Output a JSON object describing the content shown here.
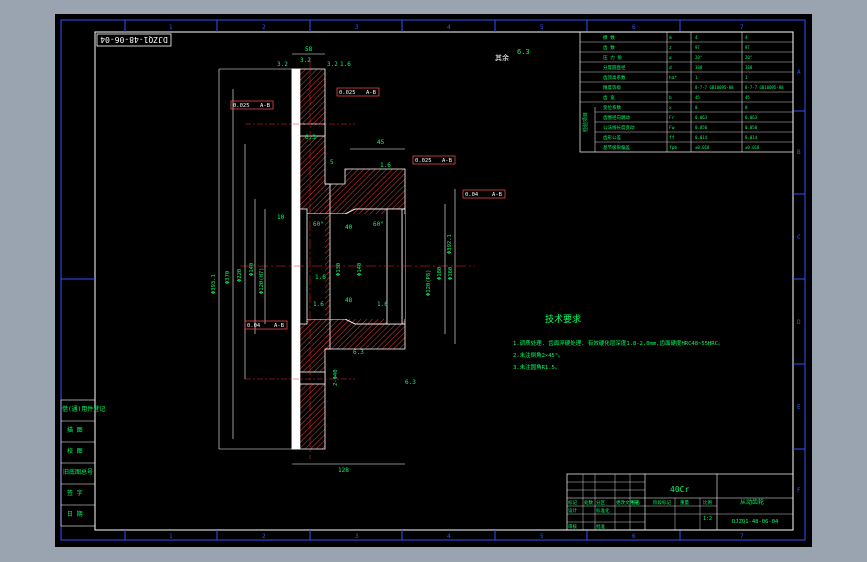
{
  "drawing_code_rotated": "DJZQ1-48-06-04",
  "surface_roughness_all": "6.3",
  "surface_roughness_prefix": "其余",
  "dims": {
    "top_width": "58",
    "r1": "3.2",
    "r2": "3.2",
    "r3": "3.2",
    "r4": "1.6",
    "r5": "6.3",
    "r6": "1.6",
    "r7": "1.6",
    "r8": "1.6",
    "r9": "1.6",
    "r10": "6.3",
    "w_hub": "48",
    "w_15": "5",
    "w_10": "10",
    "w_40": "40",
    "w_right": "45",
    "bottom_len": "128",
    "angle1": "60°",
    "angle2": "60°",
    "phi_outer": "Φ393.1",
    "phi_a": "Φ370",
    "phi_b": "Φ220",
    "phi_c": "Φ140",
    "phi_d": "Φ120(H7)",
    "phi_e": "Φ130",
    "phi_f": "Φ120(P8)",
    "phi_g": "Φ180",
    "phi_h": "Φ160",
    "phi_i": "Φ140",
    "phi_j": "Φ392.1",
    "bore_note": "2-Φ40"
  },
  "tolerances": {
    "t1_val": "0.025",
    "t1_ref": "A-B",
    "t2_val": "0.025",
    "t2_ref": "A-B",
    "t3_val": "0.025",
    "t3_ref": "A-B",
    "t4_val": "0.04",
    "t4_ref": "A-B",
    "t5_val": "0.04",
    "t5_ref": "A-B"
  },
  "params_table": {
    "rows": [
      [
        "模    数",
        "m",
        "4",
        "4"
      ],
      [
        "齿    数",
        "z",
        "97",
        "97"
      ],
      [
        "压 力 角",
        "α",
        "20°",
        "20°"
      ],
      [
        "分度圆直径",
        "d",
        "388",
        "388"
      ],
      [
        "齿顶高系数",
        "ha*",
        "1",
        "1"
      ],
      [
        "精度等级",
        "",
        "8-7-7 GB10095-88",
        "8-7-7 GB10095-88"
      ],
      [
        "齿    宽",
        "b",
        "45",
        "45"
      ],
      [
        "变位系数",
        "x",
        "0",
        "0"
      ],
      [
        "齿圈径向跳动",
        "Fr",
        "0.063",
        "0.063"
      ],
      [
        "公法线长度变动",
        "Fw",
        "0.050",
        "0.050"
      ],
      [
        "齿形公差",
        "ff",
        "0.014",
        "0.014"
      ],
      [
        "基节极限偏差",
        "fpb",
        "±0.018",
        "±0.018"
      ]
    ],
    "group_label": "检验项目"
  },
  "tech_req": {
    "title": "技术要求",
    "lines": [
      "1.调质处理, 齿面淬硬处理, 有效硬化层深度1.8-2.0mm,齿面硬度HRC48~55HRC。",
      "2.未注倒角2×45°。",
      "3.未注圆角R1.5。"
    ]
  },
  "left_table": [
    "借(通)用件登记",
    "描    图",
    "校    图",
    "旧底图总号",
    "签    字",
    "日    期"
  ],
  "title_block": {
    "material": "40Cr",
    "part_name": "从动齿轮",
    "drawing_no": "DJZQ1-48-06-04",
    "scale": "1:2",
    "row_labels": [
      "标记",
      "处数",
      "分区",
      "更改文件号",
      "签名",
      "年月日"
    ],
    "designer_label": "设计",
    "std_label": "标准化",
    "review_label": "审核",
    "approve_label": "批准",
    "stage_label": "阶段标记",
    "weight_label": "重量",
    "scale_label": "比例",
    "sheet_label": "共 张 第 张"
  },
  "zones_top": [
    "1",
    "2",
    "3",
    "4",
    "5",
    "6",
    "7"
  ],
  "zones_side": [
    "A",
    "B",
    "C",
    "D",
    "E",
    "F"
  ]
}
